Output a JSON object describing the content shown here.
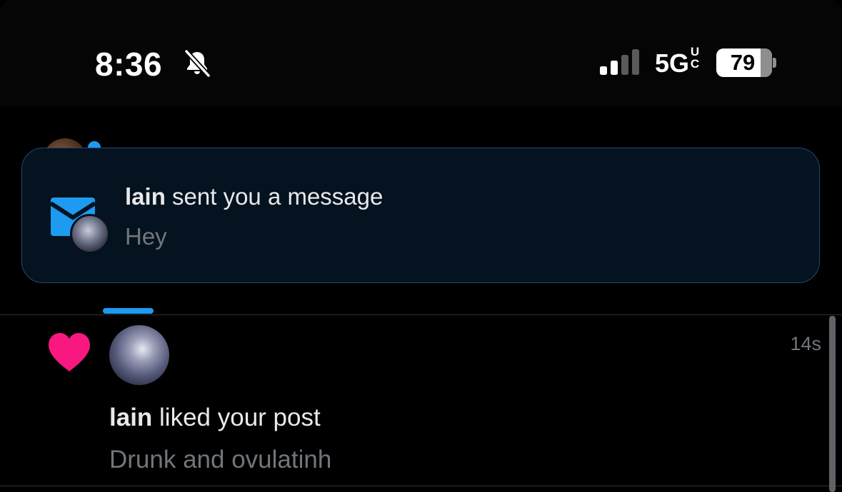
{
  "status_bar": {
    "time": "8:36",
    "silent_icon": "bell-slash-icon",
    "signal_icon": "cellular-signal-icon",
    "signal_bars_active": 2,
    "signal_bars_total": 4,
    "network": "5G",
    "network_suffix_top": "U",
    "network_suffix_bottom": "C",
    "battery_percent": "79",
    "battery_level": 0.79
  },
  "toast": {
    "icon": "envelope-icon",
    "sender": "lain",
    "action": " sent you a message",
    "preview": "Hey"
  },
  "notification": {
    "icon": "heart-icon",
    "user": "lain",
    "action": " liked your post",
    "time": "14s",
    "post_text": "Drunk and ovulatinh"
  },
  "colors": {
    "accent": "#1d9bf0",
    "like": "#f91880",
    "background": "#000000",
    "toast_background": "#05121f",
    "text_primary": "#e7e9ea",
    "text_secondary": "#71767b"
  }
}
